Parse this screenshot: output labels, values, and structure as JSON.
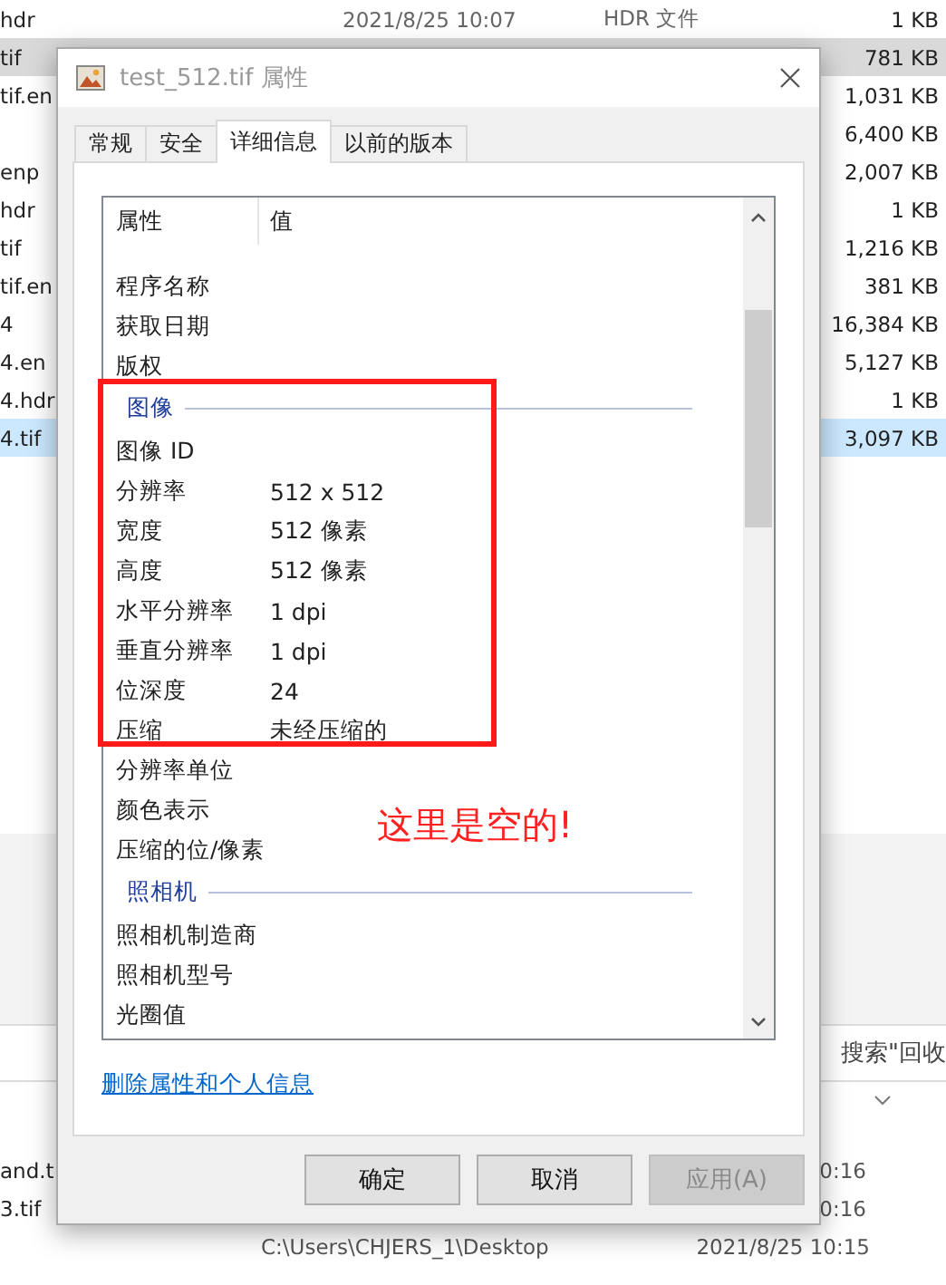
{
  "explorer": {
    "files": [
      {
        "name": "hdr",
        "date": "2021/8/25 10:07",
        "type": "HDR 文件",
        "size": "1 KB",
        "selected": false
      },
      {
        "name": "tif",
        "size": "781 KB",
        "selected": true
      },
      {
        "name": "tif.en",
        "size": "1,031 KB",
        "selected": false
      },
      {
        "size": "6,400 KB",
        "selected": false
      },
      {
        "name": "enp",
        "size": "2,007 KB",
        "selected": false
      },
      {
        "name": "hdr",
        "size": "1 KB",
        "selected": false
      },
      {
        "name": "tif",
        "size": "1,216 KB",
        "selected": false
      },
      {
        "name": "tif.en",
        "size": "381 KB",
        "selected": false
      },
      {
        "name": "4",
        "size": "16,384 KB",
        "selected": false
      },
      {
        "name": "4.en",
        "size": "5,127 KB",
        "selected": false
      },
      {
        "name": "4.hdr",
        "size": "1 KB",
        "selected": false
      },
      {
        "name": "4.tif",
        "size": "3,097 KB",
        "selected": true
      }
    ],
    "search": "搜索\"回收",
    "bottom_rows": [
      {
        "name": "and.t",
        "time": "0:16"
      },
      {
        "name": "3.tif",
        "time": "0:16"
      },
      {
        "location": "C:\\Users\\CHJERS_1\\Desktop",
        "time": "2021/8/25 10:15"
      }
    ]
  },
  "dialog": {
    "title": "test_512.tif 属性",
    "tabs": [
      {
        "label": "常规",
        "selected": false
      },
      {
        "label": "安全",
        "selected": false
      },
      {
        "label": "详细信息",
        "selected": true
      },
      {
        "label": "以前的版本",
        "selected": false
      }
    ],
    "columns": [
      "属性",
      "值"
    ],
    "rows": [
      {
        "kind": "property",
        "name": "程序名称"
      },
      {
        "kind": "property",
        "name": "获取日期"
      },
      {
        "kind": "property",
        "name": "版权"
      },
      {
        "kind": "group",
        "name": "图像"
      },
      {
        "kind": "property",
        "name": "图像 ID"
      },
      {
        "kind": "property",
        "name": "分辨率",
        "value": "512 x 512"
      },
      {
        "kind": "property",
        "name": "宽度",
        "value": "512 像素"
      },
      {
        "kind": "property",
        "name": "高度",
        "value": "512 像素"
      },
      {
        "kind": "property",
        "name": "水平分辨率",
        "value": "1 dpi"
      },
      {
        "kind": "property",
        "name": "垂直分辨率",
        "value": "1 dpi"
      },
      {
        "kind": "property",
        "name": "位深度",
        "value": "24"
      },
      {
        "kind": "property",
        "name": "压缩",
        "value": "未经压缩的"
      },
      {
        "kind": "property",
        "name": "分辨率单位"
      },
      {
        "kind": "property",
        "name": "颜色表示"
      },
      {
        "kind": "property",
        "name": "压缩的位/像素"
      },
      {
        "kind": "group",
        "name": "照相机"
      },
      {
        "kind": "property",
        "name": "照相机制造商"
      },
      {
        "kind": "property",
        "name": "照相机型号"
      },
      {
        "kind": "property",
        "name": "光圈值"
      }
    ],
    "link": "删除属性和个人信息",
    "buttons": [
      {
        "label": "确定",
        "disabled": false
      },
      {
        "label": "取消",
        "disabled": false
      },
      {
        "label": "应用(A)",
        "disabled": true
      }
    ]
  },
  "annotation": {
    "text": "这里是空的!"
  }
}
